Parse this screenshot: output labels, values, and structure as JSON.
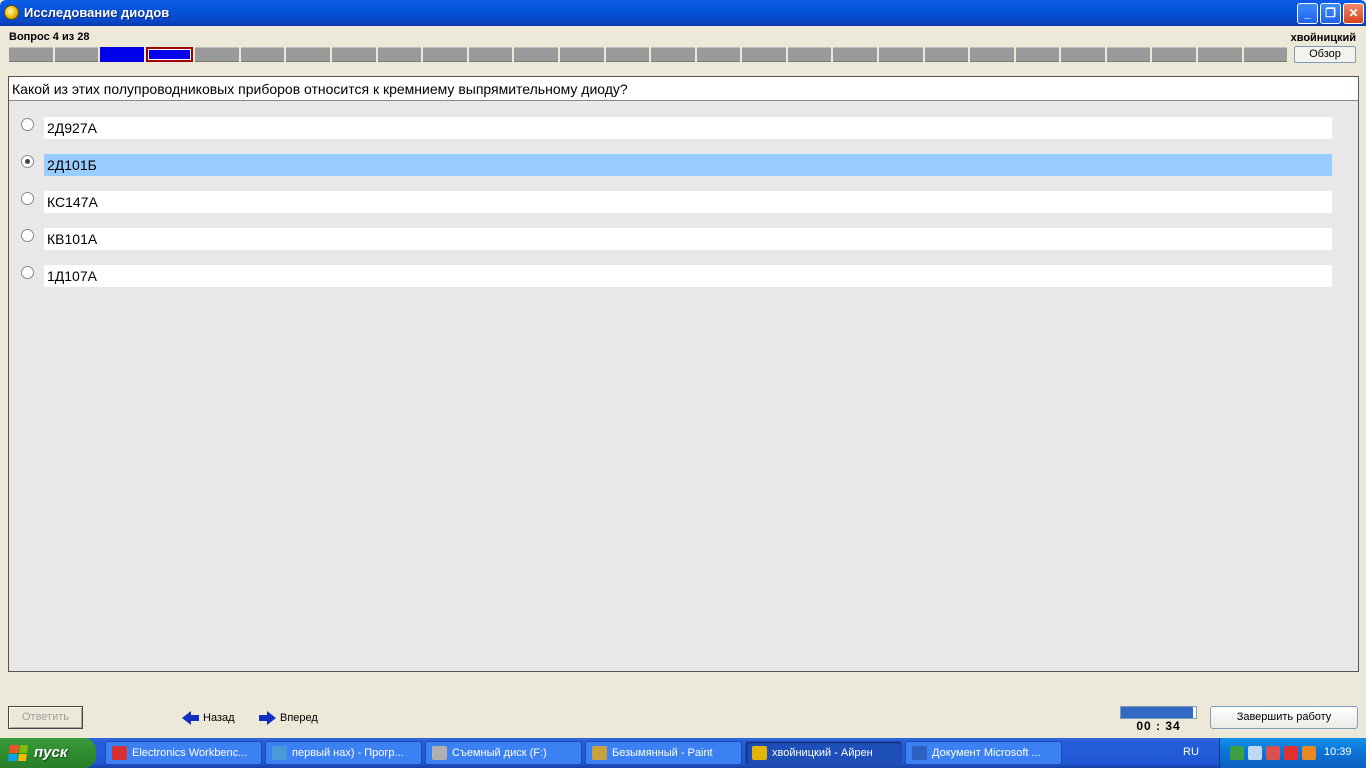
{
  "window": {
    "title": "Исследование диодов",
    "username": "хвойницкий"
  },
  "progress": {
    "counter": "Вопрос 4 из 28",
    "total": 28,
    "answered": [
      3
    ],
    "current": 4,
    "overview_label": "Обзор"
  },
  "question": {
    "text": "Какой из этих полупроводниковых приборов относится к кремниему выпрямительному диоду?",
    "options": [
      {
        "label": "2Д927А",
        "checked": false
      },
      {
        "label": "2Д101Б",
        "checked": true
      },
      {
        "label": "КС147А",
        "checked": false
      },
      {
        "label": "КВ101А",
        "checked": false
      },
      {
        "label": "1Д107А",
        "checked": false
      }
    ]
  },
  "toolbar": {
    "answer_label": "Ответить",
    "back_label": "Назад",
    "forward_label": "Вперед",
    "timer": "00 : 34",
    "timer_fill_fraction": 0.96,
    "finish_label": "Завершить работу"
  },
  "taskbar": {
    "start_label": "пуск",
    "tasks": [
      {
        "label": "Electronics Workbenc...",
        "icon_color": "#d83030"
      },
      {
        "label": "первый нах) - Прогр...",
        "icon_color": "#4a9ad8"
      },
      {
        "label": "Съемный диск (F:)",
        "icon_color": "#b0b0b0"
      },
      {
        "label": "Безымянный - Paint",
        "icon_color": "#c8a040"
      },
      {
        "label": "хвойницкий - Айрен",
        "icon_color": "#e4b500",
        "active": true
      },
      {
        "label": "Документ Microsoft ...",
        "icon_color": "#3060c0"
      }
    ],
    "language": "RU",
    "clock": "10:39"
  },
  "colors": {
    "answered_cell": "#0000ee",
    "current_border": "#a00000",
    "selected_option": "#99ccff"
  }
}
